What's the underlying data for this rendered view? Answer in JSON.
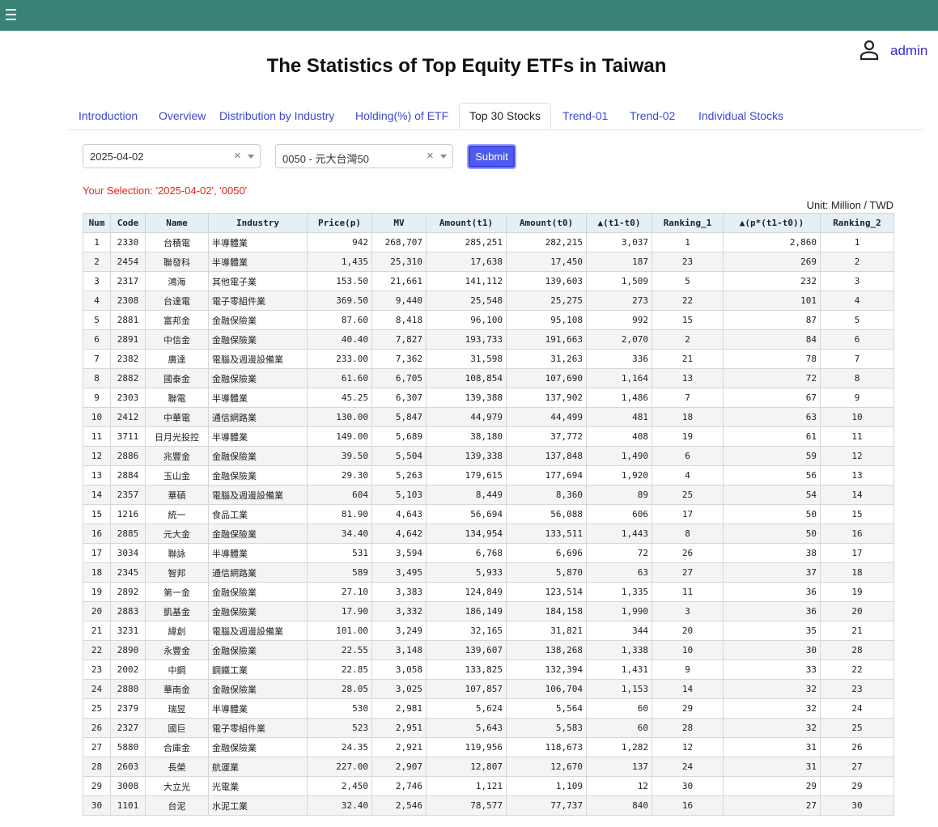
{
  "header": {
    "menu_icon": "hamburger-icon",
    "user_icon": "person-icon",
    "user_label": "admin",
    "bar_color": "#3b8276"
  },
  "page_title": "The Statistics of Top Equity ETFs in Taiwan",
  "tabs": [
    {
      "label": "Introduction",
      "active": false
    },
    {
      "label": "Overview",
      "active": false
    },
    {
      "label": "Distribution by Industry",
      "active": false
    },
    {
      "label": "Holding(%) of ETF",
      "active": false
    },
    {
      "label": "Top 30 Stocks",
      "active": true
    },
    {
      "label": "Trend-01",
      "active": false
    },
    {
      "label": "Trend-02",
      "active": false
    },
    {
      "label": "Individual Stocks",
      "active": false
    }
  ],
  "filters": {
    "date_value": "2025-04-02",
    "etf_value": "0050 - 元大台灣50",
    "clear_glyph": "×",
    "submit_label": "Submit"
  },
  "selection_text": "Your Selection: '2025-04-02', '0050'",
  "unit_text": "Unit: Million / TWD",
  "table": {
    "columns": [
      "Num",
      "Code",
      "Name",
      "Industry",
      "Price(p)",
      "MV",
      "Amount(t1)",
      "Amount(t0)",
      "▲(t1-t0)",
      "Ranking_1",
      "▲(p*(t1-t0))",
      "Ranking_2"
    ],
    "rows": [
      [
        "1",
        "2330",
        "台積電",
        "半導體業",
        "942",
        "268,707",
        "285,251",
        "282,215",
        "3,037",
        "1",
        "2,860",
        "1"
      ],
      [
        "2",
        "2454",
        "聯發科",
        "半導體業",
        "1,435",
        "25,310",
        "17,638",
        "17,450",
        "187",
        "23",
        "269",
        "2"
      ],
      [
        "3",
        "2317",
        "鴻海",
        "其他電子業",
        "153.50",
        "21,661",
        "141,112",
        "139,603",
        "1,509",
        "5",
        "232",
        "3"
      ],
      [
        "4",
        "2308",
        "台達電",
        "電子零組件業",
        "369.50",
        "9,440",
        "25,548",
        "25,275",
        "273",
        "22",
        "101",
        "4"
      ],
      [
        "5",
        "2881",
        "富邦金",
        "金融保險業",
        "87.60",
        "8,418",
        "96,100",
        "95,108",
        "992",
        "15",
        "87",
        "5"
      ],
      [
        "6",
        "2891",
        "中信金",
        "金融保險業",
        "40.40",
        "7,827",
        "193,733",
        "191,663",
        "2,070",
        "2",
        "84",
        "6"
      ],
      [
        "7",
        "2382",
        "廣達",
        "電腦及週邊設備業",
        "233.00",
        "7,362",
        "31,598",
        "31,263",
        "336",
        "21",
        "78",
        "7"
      ],
      [
        "8",
        "2882",
        "國泰金",
        "金融保險業",
        "61.60",
        "6,705",
        "108,854",
        "107,690",
        "1,164",
        "13",
        "72",
        "8"
      ],
      [
        "9",
        "2303",
        "聯電",
        "半導體業",
        "45.25",
        "6,307",
        "139,388",
        "137,902",
        "1,486",
        "7",
        "67",
        "9"
      ],
      [
        "10",
        "2412",
        "中華電",
        "通信網路業",
        "130.00",
        "5,847",
        "44,979",
        "44,499",
        "481",
        "18",
        "63",
        "10"
      ],
      [
        "11",
        "3711",
        "日月光投控",
        "半導體業",
        "149.00",
        "5,689",
        "38,180",
        "37,772",
        "408",
        "19",
        "61",
        "11"
      ],
      [
        "12",
        "2886",
        "兆豐金",
        "金融保險業",
        "39.50",
        "5,504",
        "139,338",
        "137,848",
        "1,490",
        "6",
        "59",
        "12"
      ],
      [
        "13",
        "2884",
        "玉山金",
        "金融保險業",
        "29.30",
        "5,263",
        "179,615",
        "177,694",
        "1,920",
        "4",
        "56",
        "13"
      ],
      [
        "14",
        "2357",
        "華碩",
        "電腦及週邊設備業",
        "604",
        "5,103",
        "8,449",
        "8,360",
        "89",
        "25",
        "54",
        "14"
      ],
      [
        "15",
        "1216",
        "統一",
        "食品工業",
        "81.90",
        "4,643",
        "56,694",
        "56,088",
        "606",
        "17",
        "50",
        "15"
      ],
      [
        "16",
        "2885",
        "元大金",
        "金融保險業",
        "34.40",
        "4,642",
        "134,954",
        "133,511",
        "1,443",
        "8",
        "50",
        "16"
      ],
      [
        "17",
        "3034",
        "聯詠",
        "半導體業",
        "531",
        "3,594",
        "6,768",
        "6,696",
        "72",
        "26",
        "38",
        "17"
      ],
      [
        "18",
        "2345",
        "智邦",
        "通信網路業",
        "589",
        "3,495",
        "5,933",
        "5,870",
        "63",
        "27",
        "37",
        "18"
      ],
      [
        "19",
        "2892",
        "第一金",
        "金融保險業",
        "27.10",
        "3,383",
        "124,849",
        "123,514",
        "1,335",
        "11",
        "36",
        "19"
      ],
      [
        "20",
        "2883",
        "凱基金",
        "金融保險業",
        "17.90",
        "3,332",
        "186,149",
        "184,158",
        "1,990",
        "3",
        "36",
        "20"
      ],
      [
        "21",
        "3231",
        "緯創",
        "電腦及週邊設備業",
        "101.00",
        "3,249",
        "32,165",
        "31,821",
        "344",
        "20",
        "35",
        "21"
      ],
      [
        "22",
        "2890",
        "永豐金",
        "金融保險業",
        "22.55",
        "3,148",
        "139,607",
        "138,268",
        "1,338",
        "10",
        "30",
        "28"
      ],
      [
        "23",
        "2002",
        "中鋼",
        "鋼鐵工業",
        "22.85",
        "3,058",
        "133,825",
        "132,394",
        "1,431",
        "9",
        "33",
        "22"
      ],
      [
        "24",
        "2880",
        "華南金",
        "金融保險業",
        "28.05",
        "3,025",
        "107,857",
        "106,704",
        "1,153",
        "14",
        "32",
        "23"
      ],
      [
        "25",
        "2379",
        "瑞昱",
        "半導體業",
        "530",
        "2,981",
        "5,624",
        "5,564",
        "60",
        "29",
        "32",
        "24"
      ],
      [
        "26",
        "2327",
        "國巨",
        "電子零組件業",
        "523",
        "2,951",
        "5,643",
        "5,583",
        "60",
        "28",
        "32",
        "25"
      ],
      [
        "27",
        "5880",
        "合庫金",
        "金融保險業",
        "24.35",
        "2,921",
        "119,956",
        "118,673",
        "1,282",
        "12",
        "31",
        "26"
      ],
      [
        "28",
        "2603",
        "長榮",
        "航運業",
        "227.00",
        "2,907",
        "12,807",
        "12,670",
        "137",
        "24",
        "31",
        "27"
      ],
      [
        "29",
        "3008",
        "大立光",
        "光電業",
        "2,450",
        "2,746",
        "1,121",
        "1,109",
        "12",
        "30",
        "29",
        "29"
      ],
      [
        "30",
        "1101",
        "台泥",
        "水泥工業",
        "32.40",
        "2,546",
        "78,577",
        "77,737",
        "840",
        "16",
        "27",
        "30"
      ]
    ]
  }
}
